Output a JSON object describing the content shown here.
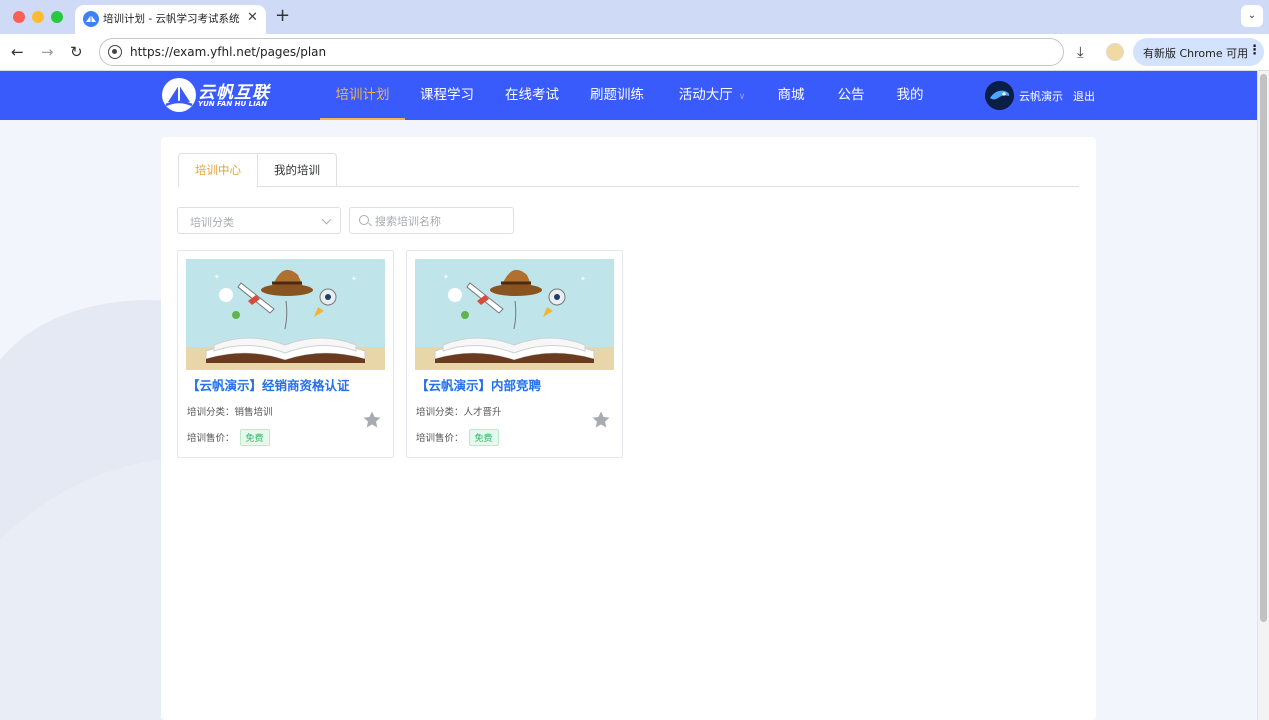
{
  "browser": {
    "tab_title": "培训计划 - 云帆学习考试系统",
    "tab_close": "✕",
    "new_tab": "+",
    "tab_menu": "⌄",
    "url": "https://exam.yfhl.net/pages/plan",
    "update_label": "有新版 Chrome 可用",
    "icons": [
      "back-icon",
      "forward-icon",
      "reload-icon",
      "site-info-icon",
      "download-icon",
      "profile-icon",
      "more-icon"
    ]
  },
  "header": {
    "logo_text": "云帆互联",
    "logo_sub": "YUN FAN HU LIAN",
    "nav": [
      {
        "label": "培训计划",
        "active": true
      },
      {
        "label": "课程学习"
      },
      {
        "label": "在线考试"
      },
      {
        "label": "刷题训练"
      },
      {
        "label": "活动大厅",
        "caret": "∨"
      },
      {
        "label": "商城"
      },
      {
        "label": "公告"
      },
      {
        "label": "我的"
      }
    ],
    "user_name": "云帆演示",
    "logout": "退出",
    "accent_color": "#3a5bfb",
    "active_color": "#f5b544"
  },
  "panel": {
    "tabs": [
      {
        "label": "培训中心",
        "active": true
      },
      {
        "label": "我的培训"
      }
    ],
    "filter": {
      "category_placeholder": "培训分类",
      "search_placeholder": "搜索培训名称"
    },
    "cards": [
      {
        "title": "【云帆演示】经销商资格认证",
        "category_label": "培训分类：",
        "category": "销售培训",
        "price_label": "培训售价：",
        "price": "免费"
      },
      {
        "title": "【云帆演示】内部竞聘",
        "category_label": "培训分类：",
        "category": "人才晋升",
        "price_label": "培训售价：",
        "price": "免费"
      }
    ]
  }
}
